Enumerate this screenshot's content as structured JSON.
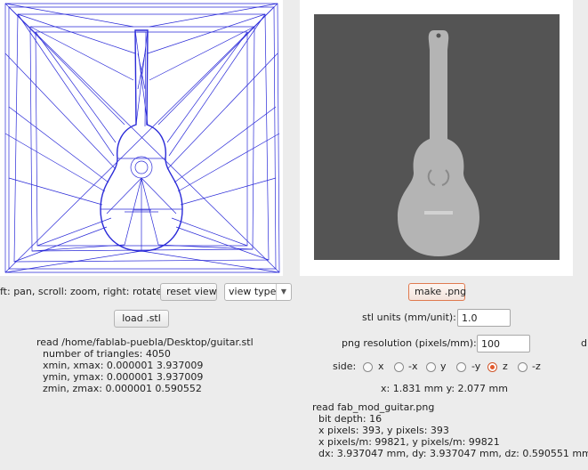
{
  "left": {
    "hint": "ft: pan, scroll: zoom, right: rotate",
    "reset_view": "reset view",
    "view_type": "view type",
    "load_stl": "load .stl",
    "info": [
      "read /home/fablab-puebla/Desktop/guitar.stl",
      "number of triangles: 4050",
      "xmin, xmax: 0.000001 3.937009",
      "ymin, ymax: 0.000001 3.937009",
      "zmin, zmax: 0.000001 0.590552"
    ]
  },
  "right": {
    "make_png": "make .png",
    "units_label": "stl units (mm/unit):",
    "units_value": "1.0",
    "res_label": "png resolution (pixels/mm):",
    "res_value": "100",
    "side_label": "side:",
    "sides": [
      "x",
      "-x",
      "y",
      "-y",
      "z",
      "-z"
    ],
    "selected_side": "z",
    "coords": "x: 1.831 mm  y: 2.077 mm",
    "info": [
      "read fab_mod_guitar.png",
      "bit depth: 16",
      "x pixels: 393, y pixels: 393",
      "x pixels/m: 99821, y pixels/m: 99821",
      "dx: 3.937047 mm, dy: 3.937047 mm, dz: 0.590551 mm"
    ],
    "edge_text": "d"
  },
  "colors": {
    "mesh": "#2a2ad8",
    "accent": "#e2592b",
    "png_bg": "#545454",
    "guitar": "#b4b4b4"
  }
}
